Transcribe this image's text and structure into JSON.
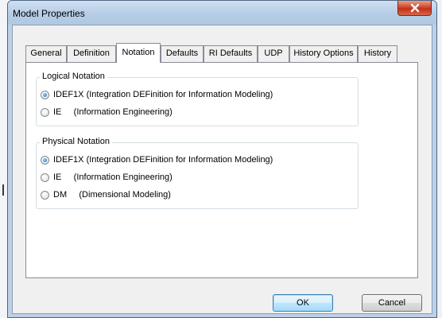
{
  "window": {
    "title": "Model Properties",
    "close_icon": "close-x-icon"
  },
  "tabs": [
    {
      "label": "General",
      "active": false
    },
    {
      "label": "Definition",
      "active": false
    },
    {
      "label": "Notation",
      "active": true
    },
    {
      "label": "Defaults",
      "active": false
    },
    {
      "label": "RI Defaults",
      "active": false
    },
    {
      "label": "UDP",
      "active": false
    },
    {
      "label": "History Options",
      "active": false
    },
    {
      "label": "History",
      "active": false
    }
  ],
  "logical": {
    "label": "Logical Notation",
    "options": [
      {
        "label": "IDEF1X (Integration DEFinition for Information Modeling)",
        "checked": true
      },
      {
        "label": "IE     (Information Engineering)",
        "checked": false
      }
    ]
  },
  "physical": {
    "label": "Physical Notation",
    "options": [
      {
        "label": "IDEF1X (Integration DEFinition for Information Modeling)",
        "checked": true
      },
      {
        "label": "IE     (Information Engineering)",
        "checked": false
      },
      {
        "label": "DM     (Dimensional Modeling)",
        "checked": false
      }
    ]
  },
  "buttons": {
    "ok": "OK",
    "cancel": "Cancel"
  },
  "colors": {
    "title_bar": "#bcd0e6",
    "close_button": "#c8412a",
    "default_button_border": "#3c7fb1",
    "radio_dot": "#1e73c8"
  }
}
